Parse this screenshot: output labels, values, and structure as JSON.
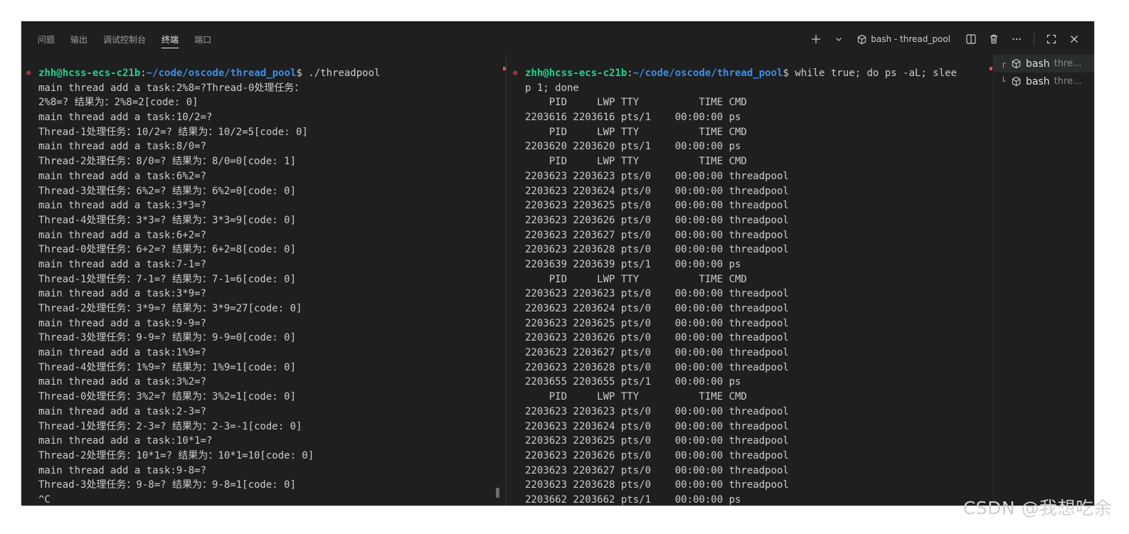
{
  "panel": {
    "tabs": [
      {
        "label": "问题"
      },
      {
        "label": "输出"
      },
      {
        "label": "调试控制台"
      },
      {
        "label": "终端"
      },
      {
        "label": "端口"
      }
    ],
    "active_tab": "终端",
    "terminal_title": "bash - thread_pool"
  },
  "left_terminal": {
    "prompt_user": "zhh@hcss-ecs-c21b",
    "prompt_path": "~/code/oscode/thread_pool",
    "prompt_cmd": "$ ./threadpool",
    "lines": [
      "main thread add a task:2%8=?Thread-0处理任务：",
      "2%8=? 结果为：2%8=2[code: 0]",
      "main thread add a task:10/2=?",
      "Thread-1处理任务：10/2=? 结果为：10/2=5[code: 0]",
      "main thread add a task:8/0=?",
      "Thread-2处理任务：8/0=? 结果为：8/0=0[code: 1]",
      "main thread add a task:6%2=?",
      "Thread-3处理任务：6%2=? 结果为：6%2=0[code: 0]",
      "main thread add a task:3*3=?",
      "Thread-4处理任务：3*3=? 结果为：3*3=9[code: 0]",
      "main thread add a task:6+2=?",
      "Thread-0处理任务：6+2=? 结果为：6+2=8[code: 0]",
      "main thread add a task:7-1=?",
      "Thread-1处理任务：7-1=? 结果为：7-1=6[code: 0]",
      "main thread add a task:3*9=?",
      "Thread-2处理任务：3*9=? 结果为：3*9=27[code: 0]",
      "main thread add a task:9-9=?",
      "Thread-3处理任务：9-9=? 结果为：9-9=0[code: 0]",
      "main thread add a task:1%9=?",
      "Thread-4处理任务：1%9=? 结果为：1%9=1[code: 0]",
      "main thread add a task:3%2=?",
      "Thread-0处理任务：3%2=? 结果为：3%2=1[code: 0]",
      "main thread add a task:2-3=?",
      "Thread-1处理任务：2-3=? 结果为：2-3=-1[code: 0]",
      "main thread add a task:10*1=?",
      "Thread-2处理任务：10*1=? 结果为：10*1=10[code: 0]",
      "main thread add a task:9-8=?",
      "Thread-3处理任务：9-8=? 结果为：9-8=1[code: 0]",
      "^C"
    ]
  },
  "right_terminal": {
    "prompt_user": "zhh@hcss-ecs-c21b",
    "prompt_path": "~/code/oscode/thread_pool",
    "prompt_cmd": "$ while true; do ps -aL; slee",
    "lines": [
      "p 1; done",
      "    PID     LWP TTY          TIME CMD",
      "2203616 2203616 pts/1    00:00:00 ps",
      "    PID     LWP TTY          TIME CMD",
      "2203620 2203620 pts/1    00:00:00 ps",
      "    PID     LWP TTY          TIME CMD",
      "2203623 2203623 pts/0    00:00:00 threadpool",
      "2203623 2203624 pts/0    00:00:00 threadpool",
      "2203623 2203625 pts/0    00:00:00 threadpool",
      "2203623 2203626 pts/0    00:00:00 threadpool",
      "2203623 2203627 pts/0    00:00:00 threadpool",
      "2203623 2203628 pts/0    00:00:00 threadpool",
      "2203639 2203639 pts/1    00:00:00 ps",
      "    PID     LWP TTY          TIME CMD",
      "2203623 2203623 pts/0    00:00:00 threadpool",
      "2203623 2203624 pts/0    00:00:00 threadpool",
      "2203623 2203625 pts/0    00:00:00 threadpool",
      "2203623 2203626 pts/0    00:00:00 threadpool",
      "2203623 2203627 pts/0    00:00:00 threadpool",
      "2203623 2203628 pts/0    00:00:00 threadpool",
      "2203655 2203655 pts/1    00:00:00 ps",
      "    PID     LWP TTY          TIME CMD",
      "2203623 2203623 pts/0    00:00:00 threadpool",
      "2203623 2203624 pts/0    00:00:00 threadpool",
      "2203623 2203625 pts/0    00:00:00 threadpool",
      "2203623 2203626 pts/0    00:00:00 threadpool",
      "2203623 2203627 pts/0    00:00:00 threadpool",
      "2203623 2203628 pts/0    00:00:00 threadpool",
      "2203662 2203662 pts/1    00:00:00 ps"
    ]
  },
  "terminal_list": [
    {
      "tree": "┌",
      "name": "bash",
      "sub": "thre..."
    },
    {
      "tree": "└",
      "name": "bash",
      "sub": "thre..."
    }
  ],
  "watermark": "CSDN @我想吃余",
  "colors": {
    "background": "#1f1f1f",
    "prompt_user": "#23d18b",
    "prompt_path": "#3b8eea",
    "text": "#cccccc",
    "marker": "#f14c4c"
  },
  "icons": [
    "plus-icon",
    "chevron-down-icon",
    "terminal-cube-icon",
    "split-icon",
    "trash-icon",
    "more-icon",
    "maximize-icon",
    "close-icon"
  ]
}
